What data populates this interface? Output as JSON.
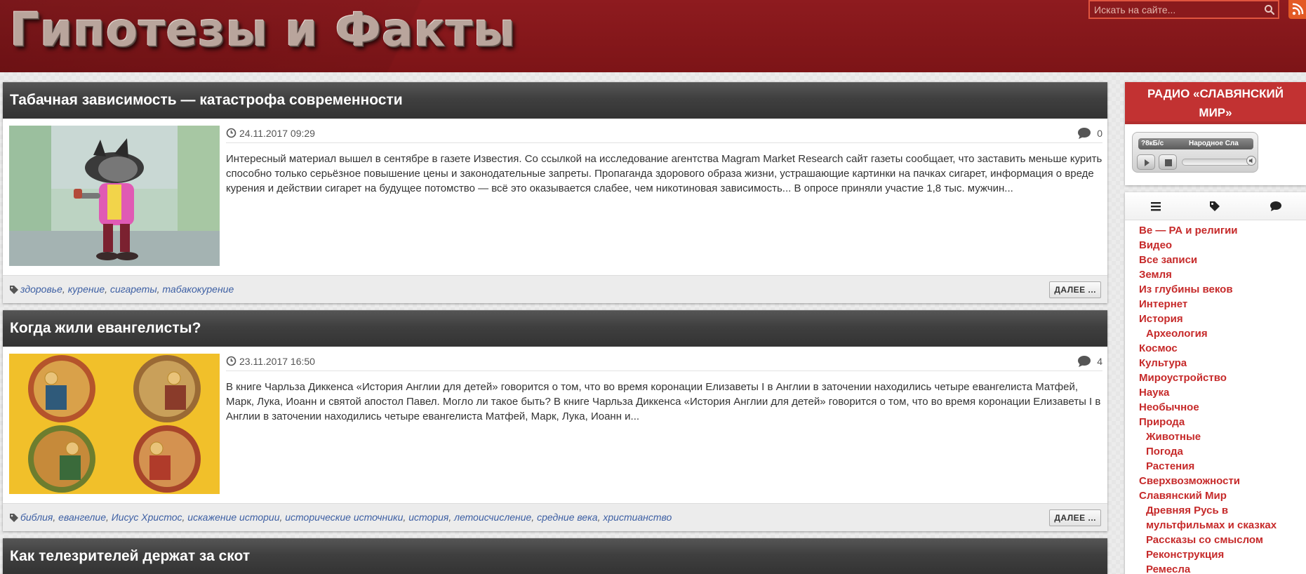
{
  "site": {
    "title": "Гипотезы и Факты"
  },
  "search": {
    "placeholder": "Искать на сайте..."
  },
  "colors": {
    "header_red": "#8e1b1f",
    "accent_red": "#c23232",
    "link_blue": "#3d5fa3",
    "rss_orange": "#e35a25"
  },
  "posts": [
    {
      "title": "Табачная зависимость — катастрофа современности",
      "date": "24.11.2017 09:29",
      "comments": "0",
      "excerpt": "Интересный материал вышел в сентябре в газете Известия. Со ссылкой на исследование агентства Magram Market Research сайт газеты сообщает, что заставить меньше курить способно только серьёзное повышение цены и законодательные запреты. Пропаганда здорового образа жизни, устрашающие картинки на пачках сигарет, информация о вреде курения и действии сигарет на будущее потомство — всё это оказывается слабее, чем никотиновая зависимость... В опросе приняли участие 1,8 тыс. мужчин...",
      "tags": [
        "здоровье",
        "курение",
        "сигареты",
        "табакокурение"
      ],
      "more": "ДАЛЕЕ ...",
      "thumb_icon": "cartoon-wolf-smoking-image"
    },
    {
      "title": "Когда жили евангелисты?",
      "date": "23.11.2017 16:50",
      "comments": "4",
      "excerpt": "В книге Чарльза Диккенса «История Англии для детей» говорится о том, что во время коронации Елизаветы I в Англии в заточении находились четыре евангелиста Матфей, Марк, Лука, Иоанн и святой апостол Павел. Могло ли такое быть? В книге Чарльза Диккенса «История Англии для детей» говорится о том, что во время коронации Елизаветы I в Англии в заточении находились четыре евангелиста Матфей, Марк, Лука, Иоанн и...",
      "tags": [
        "библия",
        "евангелие",
        "Иисус Христос",
        "искажение истории",
        "исторические источники",
        "история",
        "летоисчисление",
        "средние века",
        "христианство"
      ],
      "more": "ДАЛЕЕ ...",
      "thumb_icon": "four-evangelists-icon-image"
    },
    {
      "title": "Как телезрителей держат за скот"
    }
  ],
  "sidebar": {
    "radio": {
      "title": "РАДИО «СЛАВЯНСКИЙ МИР»",
      "bitrate": "?8кБ/с",
      "station": "Народное Сла"
    },
    "tabs": [
      "list-icon",
      "tag-icon",
      "comment-icon"
    ],
    "categories": [
      {
        "label": "Ве — РА и религии",
        "sub": false
      },
      {
        "label": "Видео",
        "sub": false
      },
      {
        "label": "Все записи",
        "sub": false
      },
      {
        "label": "Земля",
        "sub": false
      },
      {
        "label": "Из глубины веков",
        "sub": false
      },
      {
        "label": "Интернет",
        "sub": false
      },
      {
        "label": "История",
        "sub": false
      },
      {
        "label": "Археология",
        "sub": true
      },
      {
        "label": "Космос",
        "sub": false
      },
      {
        "label": "Культура",
        "sub": false
      },
      {
        "label": "Мироустройство",
        "sub": false
      },
      {
        "label": "Наука",
        "sub": false
      },
      {
        "label": "Необычное",
        "sub": false
      },
      {
        "label": "Природа",
        "sub": false
      },
      {
        "label": "Животные",
        "sub": true
      },
      {
        "label": "Погода",
        "sub": true
      },
      {
        "label": "Растения",
        "sub": true
      },
      {
        "label": "Сверхвозможности",
        "sub": false
      },
      {
        "label": "Славянский Мир",
        "sub": false
      },
      {
        "label": "Древняя Русь в",
        "sub": true
      },
      {
        "label": "мультфильмах и сказках",
        "sub": true
      },
      {
        "label": "Рассказы со смыслом",
        "sub": true
      },
      {
        "label": "Реконструкция",
        "sub": true
      },
      {
        "label": "Ремесла",
        "sub": true
      }
    ]
  }
}
